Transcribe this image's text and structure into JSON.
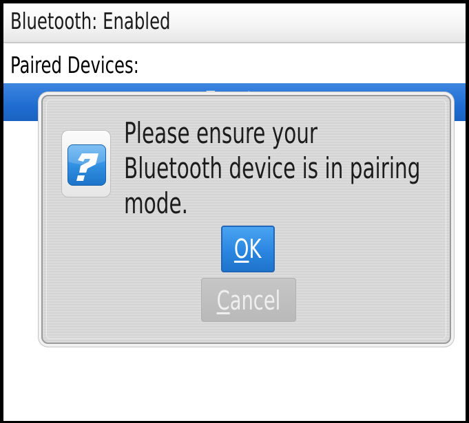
{
  "status_bar": {
    "text": "Bluetooth: Enabled"
  },
  "paired_devices": {
    "label": "Paired Devices:",
    "selected_item": "« Empty »"
  },
  "dialog": {
    "icon": "help-question-icon",
    "message_lines": [
      "Please ensure your",
      "Bluetooth device is in pairing",
      "mode."
    ],
    "ok_button": {
      "mnemonic": "O",
      "rest": "K"
    },
    "cancel_button": {
      "mnemonic": "C",
      "rest": "ancel"
    }
  },
  "colors": {
    "selection_blue": "#1f6dd1",
    "ok_button_blue": "#2a86e0",
    "dialog_gray": "#dcdcdc",
    "cancel_disabled_gray": "#bdbdbd"
  }
}
